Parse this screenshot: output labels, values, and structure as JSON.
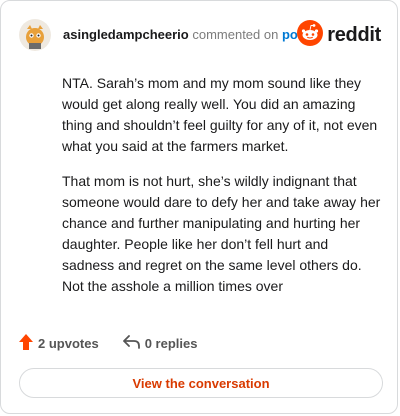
{
  "comment": {
    "username": "asingledampcheerio",
    "action_text": "commented on",
    "post_link_label": "post",
    "brand_label": "reddit",
    "paragraphs": [
      "NTA. Sarah’s mom and my mom sound like they would get along really well. You did an amazing thing and shouldn’t feel guilty for any of it, not even what you said at the farmers market.",
      "That mom is not hurt, she’s wildly indignant that someone would dare to defy her and take away her chance and further manipulating and hurting her daughter. People like her don’t fell hurt and sadness and regret on the same level others do. Not the asshole a million times over"
    ],
    "upvotes_label": "2 upvotes",
    "replies_label": "0 replies",
    "cta_label": "View the conversation"
  },
  "icons": {
    "upvote": "upvote-arrow-icon",
    "reply": "reply-arrow-icon",
    "brand": "reddit-snoo-icon",
    "avatar": "user-avatar"
  },
  "colors": {
    "upvote": "#ff4500",
    "link": "#0079d3",
    "cta": "#d93a00",
    "brand": "#ff4500"
  }
}
